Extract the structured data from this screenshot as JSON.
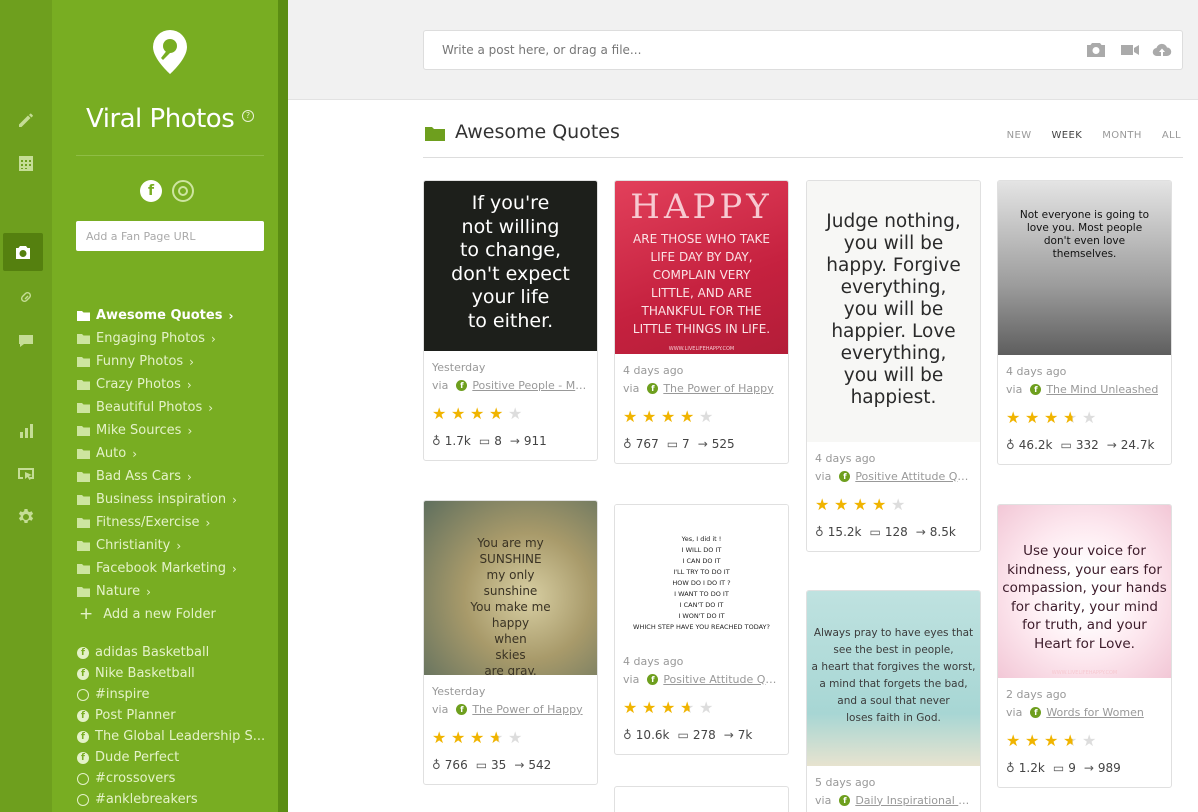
{
  "app": {
    "title": "Viral Photos",
    "help_mark": "?"
  },
  "fanpage": {
    "placeholder": "Add a Fan Page URL"
  },
  "folders": [
    {
      "label": "Awesome Quotes",
      "active": true
    },
    {
      "label": "Engaging Photos"
    },
    {
      "label": "Funny Photos"
    },
    {
      "label": "Crazy Photos"
    },
    {
      "label": "Beautiful Photos"
    },
    {
      "label": "Mike Sources"
    },
    {
      "label": "Auto"
    },
    {
      "label": "Bad Ass Cars"
    },
    {
      "label": "Business inspiration"
    },
    {
      "label": "Fitness/Exercise"
    },
    {
      "label": "Christianity"
    },
    {
      "label": "Facebook Marketing"
    },
    {
      "label": "Nature"
    }
  ],
  "add_folder": "Add a new Folder",
  "pages": [
    {
      "label": "adidas Basketball",
      "type": "facebook"
    },
    {
      "label": "Nike Basketball",
      "type": "facebook"
    },
    {
      "label": "#inspire",
      "type": "instagram"
    },
    {
      "label": "Post Planner",
      "type": "facebook"
    },
    {
      "label": "The Global Leadership S...",
      "type": "facebook"
    },
    {
      "label": "Dude Perfect",
      "type": "facebook"
    },
    {
      "label": "#crossovers",
      "type": "instagram"
    },
    {
      "label": "#anklebreakers",
      "type": "instagram"
    }
  ],
  "composer": {
    "placeholder": "Write a post here, or drag a file..."
  },
  "header": {
    "title": "Awesome Quotes"
  },
  "filters": [
    "NEW",
    "WEEK",
    "MONTH",
    "ALL"
  ],
  "active_filter": "WEEK",
  "via_label": "via",
  "cards": [
    {
      "when": "Yesterday",
      "source": "Positive People - Ma...",
      "rating": 4,
      "likes": "1.7k",
      "comments": "8",
      "shares": "911",
      "lines": [
        "If you're",
        "not willing",
        "to change,",
        "don't expect",
        "your life",
        "to either."
      ]
    },
    {
      "when": "4 days ago",
      "source": "The Power of Happy",
      "rating": 4,
      "likes": "767",
      "comments": "7",
      "shares": "525",
      "heading": "HAPPY",
      "lines": [
        "ARE THOSE WHO TAKE",
        "LIFE DAY BY DAY,",
        "COMPLAIN VERY",
        "LITTLE, AND ARE",
        "THANKFUL FOR THE",
        "LITTLE THINGS IN LIFE."
      ],
      "credit": "WWW.LIVELIFEHAPPY.COM"
    },
    {
      "when": "4 days ago",
      "source": "Positive Attitude Quo...",
      "rating": 4,
      "likes": "15.2k",
      "comments": "128",
      "shares": "8.5k",
      "lines": [
        "Judge nothing,",
        "you will be",
        "happy. Forgive",
        "everything,",
        "you will be",
        "happier. Love",
        "everything,",
        "you will be",
        "happiest."
      ]
    },
    {
      "when": "4 days ago",
      "source": "The Mind Unleashed",
      "rating": 3.5,
      "likes": "46.2k",
      "comments": "332",
      "shares": "24.7k",
      "lines": [
        "Not everyone is going to",
        "love you. Most people",
        "don't even love",
        "themselves."
      ]
    },
    {
      "when": "Yesterday",
      "source": "The Power of Happy",
      "rating": 3.5,
      "likes": "766",
      "comments": "35",
      "shares": "542",
      "lines": [
        "You are my",
        "SUNSHINE",
        "my only",
        "sunshine",
        "You make me",
        "happy",
        "when",
        "skies",
        "are gray."
      ]
    },
    {
      "when": "4 days ago",
      "source": "Positive Attitude Quo...",
      "rating": 3.5,
      "likes": "10.6k",
      "comments": "278",
      "shares": "7k",
      "lines": [
        "Yes, I did it !",
        "I WILL DO IT",
        "I CAN DO IT",
        "I'LL TRY TO DO IT",
        "HOW DO I DO IT ?",
        "I WANT TO DO IT",
        "I CAN'T DO IT",
        "I WON'T DO IT",
        "WHICH STEP HAVE YOU REACHED TODAY?"
      ]
    },
    {
      "when": "5 days ago",
      "source": "Daily Inspirational Qu...",
      "rating": 0,
      "likes": "",
      "comments": "",
      "shares": "",
      "lines": [
        "Always pray to have eyes that",
        "see the best in people,",
        "a heart that forgives the worst,",
        "a mind that forgets the bad,",
        "and a soul that never",
        "loses faith in God."
      ]
    },
    {
      "when": "2 days ago",
      "source": "Words for Women",
      "rating": 3.5,
      "likes": "1.2k",
      "comments": "9",
      "shares": "989",
      "lines": [
        "Use your voice for",
        "kindness, your ears for",
        "compassion, your hands",
        "for charity, your mind",
        "for truth, and your",
        "Heart for Love."
      ],
      "credit": "WWW.LIVELIFEHAPPY.COM"
    }
  ],
  "colors": {
    "sidebar": "#78ad22",
    "rail": "#6e9f1e",
    "accent": "#5b8d13",
    "star": "#f0b400"
  },
  "icons": {
    "rail": [
      "pencil-icon",
      "calendar-icon",
      "camera-icon",
      "link-icon",
      "chat-icon",
      "bar-chart-icon",
      "pointer-icon",
      "gear-icon"
    ],
    "composer": [
      "camera-icon",
      "video-icon",
      "cloud-upload-icon"
    ]
  }
}
